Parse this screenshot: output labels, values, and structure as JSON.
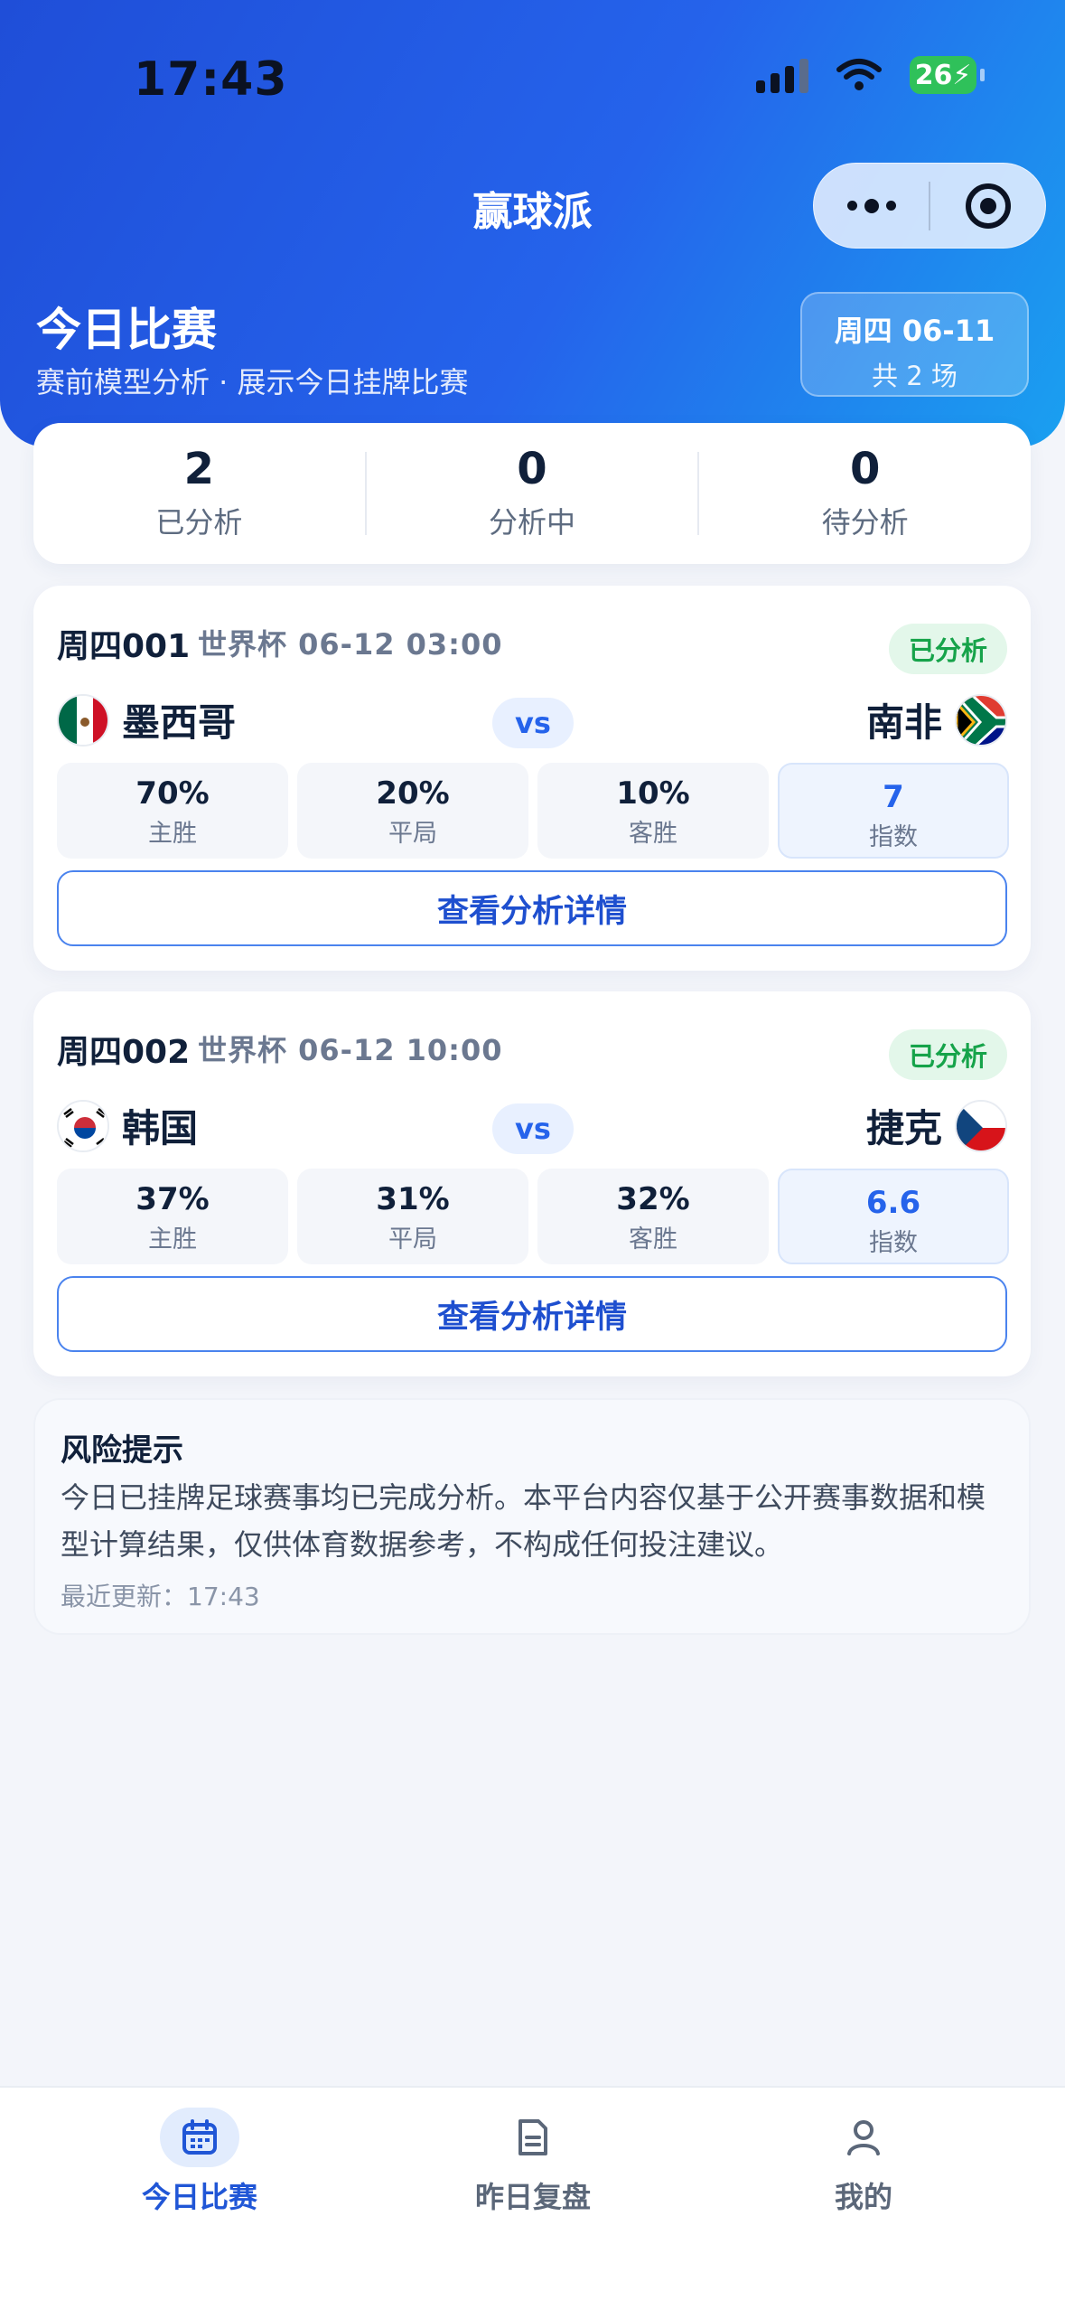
{
  "status_bar": {
    "time": "17:43",
    "battery": "26"
  },
  "header": {
    "app_title": "赢球派"
  },
  "hero": {
    "title": "今日比赛",
    "subtitle": "赛前模型分析 · 展示今日挂牌比赛",
    "date_line": "周四 06-11",
    "count_line": "共 2 场"
  },
  "stats": [
    {
      "value": "2",
      "label": "已分析"
    },
    {
      "value": "0",
      "label": "分析中"
    },
    {
      "value": "0",
      "label": "待分析"
    }
  ],
  "matches": [
    {
      "code": "周四001",
      "league": "世界杯 06-12 03:00",
      "status": "已分析",
      "home": "墨西哥",
      "away": "南非",
      "vs": "vs",
      "home_flag": "mexico-flag",
      "away_flag": "south-africa-flag",
      "win": {
        "value": "70%",
        "label": "主胜"
      },
      "draw": {
        "value": "20%",
        "label": "平局"
      },
      "loss": {
        "value": "10%",
        "label": "客胜"
      },
      "index": {
        "value": "7",
        "label": "指数"
      },
      "button": "查看分析详情"
    },
    {
      "code": "周四002",
      "league": "世界杯 06-12 10:00",
      "status": "已分析",
      "home": "韩国",
      "away": "捷克",
      "vs": "vs",
      "home_flag": "south-korea-flag",
      "away_flag": "czech-flag",
      "win": {
        "value": "37%",
        "label": "主胜"
      },
      "draw": {
        "value": "31%",
        "label": "平局"
      },
      "loss": {
        "value": "32%",
        "label": "客胜"
      },
      "index": {
        "value": "6.6",
        "label": "指数"
      },
      "button": "查看分析详情"
    }
  ],
  "risk": {
    "title": "风险提示",
    "body": "今日已挂牌足球赛事均已完成分析。本平台内容仅基于公开赛事数据和模型计算结果，仅供体育数据参考，不构成任何投注建议。",
    "updated": "最近更新：17:43"
  },
  "tabbar": [
    {
      "label": "今日比赛",
      "icon": "calendar-icon",
      "active": true
    },
    {
      "label": "昨日复盘",
      "icon": "document-icon",
      "active": false
    },
    {
      "label": "我的",
      "icon": "user-icon",
      "active": false
    }
  ],
  "colors": {
    "brand": "#2563eb",
    "success": "#16a34a",
    "background": "#f3f5fa"
  }
}
